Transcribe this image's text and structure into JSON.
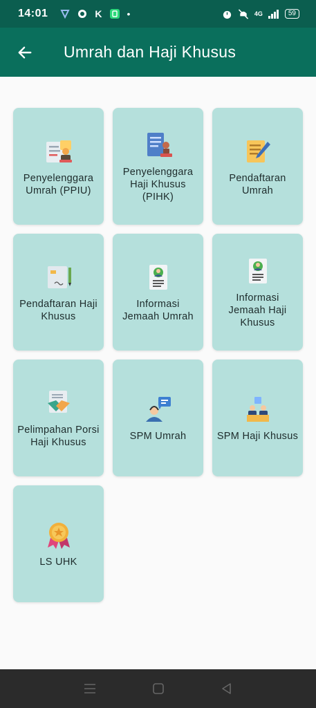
{
  "status_bar": {
    "time": "14:01",
    "signal": "4G",
    "battery": "59"
  },
  "app_bar": {
    "title": "Umrah dan Haji Khusus",
    "back_icon": "arrow-left-icon"
  },
  "tiles": [
    {
      "label": "Penyelenggara Umrah (PPIU)",
      "icon": "certificate-stamp-icon"
    },
    {
      "label": "Penyelenggara Haji Khusus (PIHK)",
      "icon": "document-stamp-icon"
    },
    {
      "label": "Pendaftaran Umrah",
      "icon": "form-pencil-icon"
    },
    {
      "label": "Pendaftaran Haji Khusus",
      "icon": "document-signature-icon"
    },
    {
      "label": "Informasi Jemaah Umrah",
      "icon": "profile-card-icon"
    },
    {
      "label": "Informasi Jemaah Haji Khusus",
      "icon": "profile-card-icon"
    },
    {
      "label": "Pelimpahan Porsi Haji Khusus",
      "icon": "handshake-document-icon"
    },
    {
      "label": "SPM Umrah",
      "icon": "support-agent-icon"
    },
    {
      "label": "SPM Haji Khusus",
      "icon": "service-desk-icon"
    },
    {
      "label": "LS UHK",
      "icon": "award-medal-icon"
    }
  ],
  "colors": {
    "status_bar": "#0b5e4f",
    "app_bar": "#0a6f5c",
    "tile": "#b5e0dc",
    "background": "#fafafa",
    "nav_bar": "#2b2b2b"
  }
}
